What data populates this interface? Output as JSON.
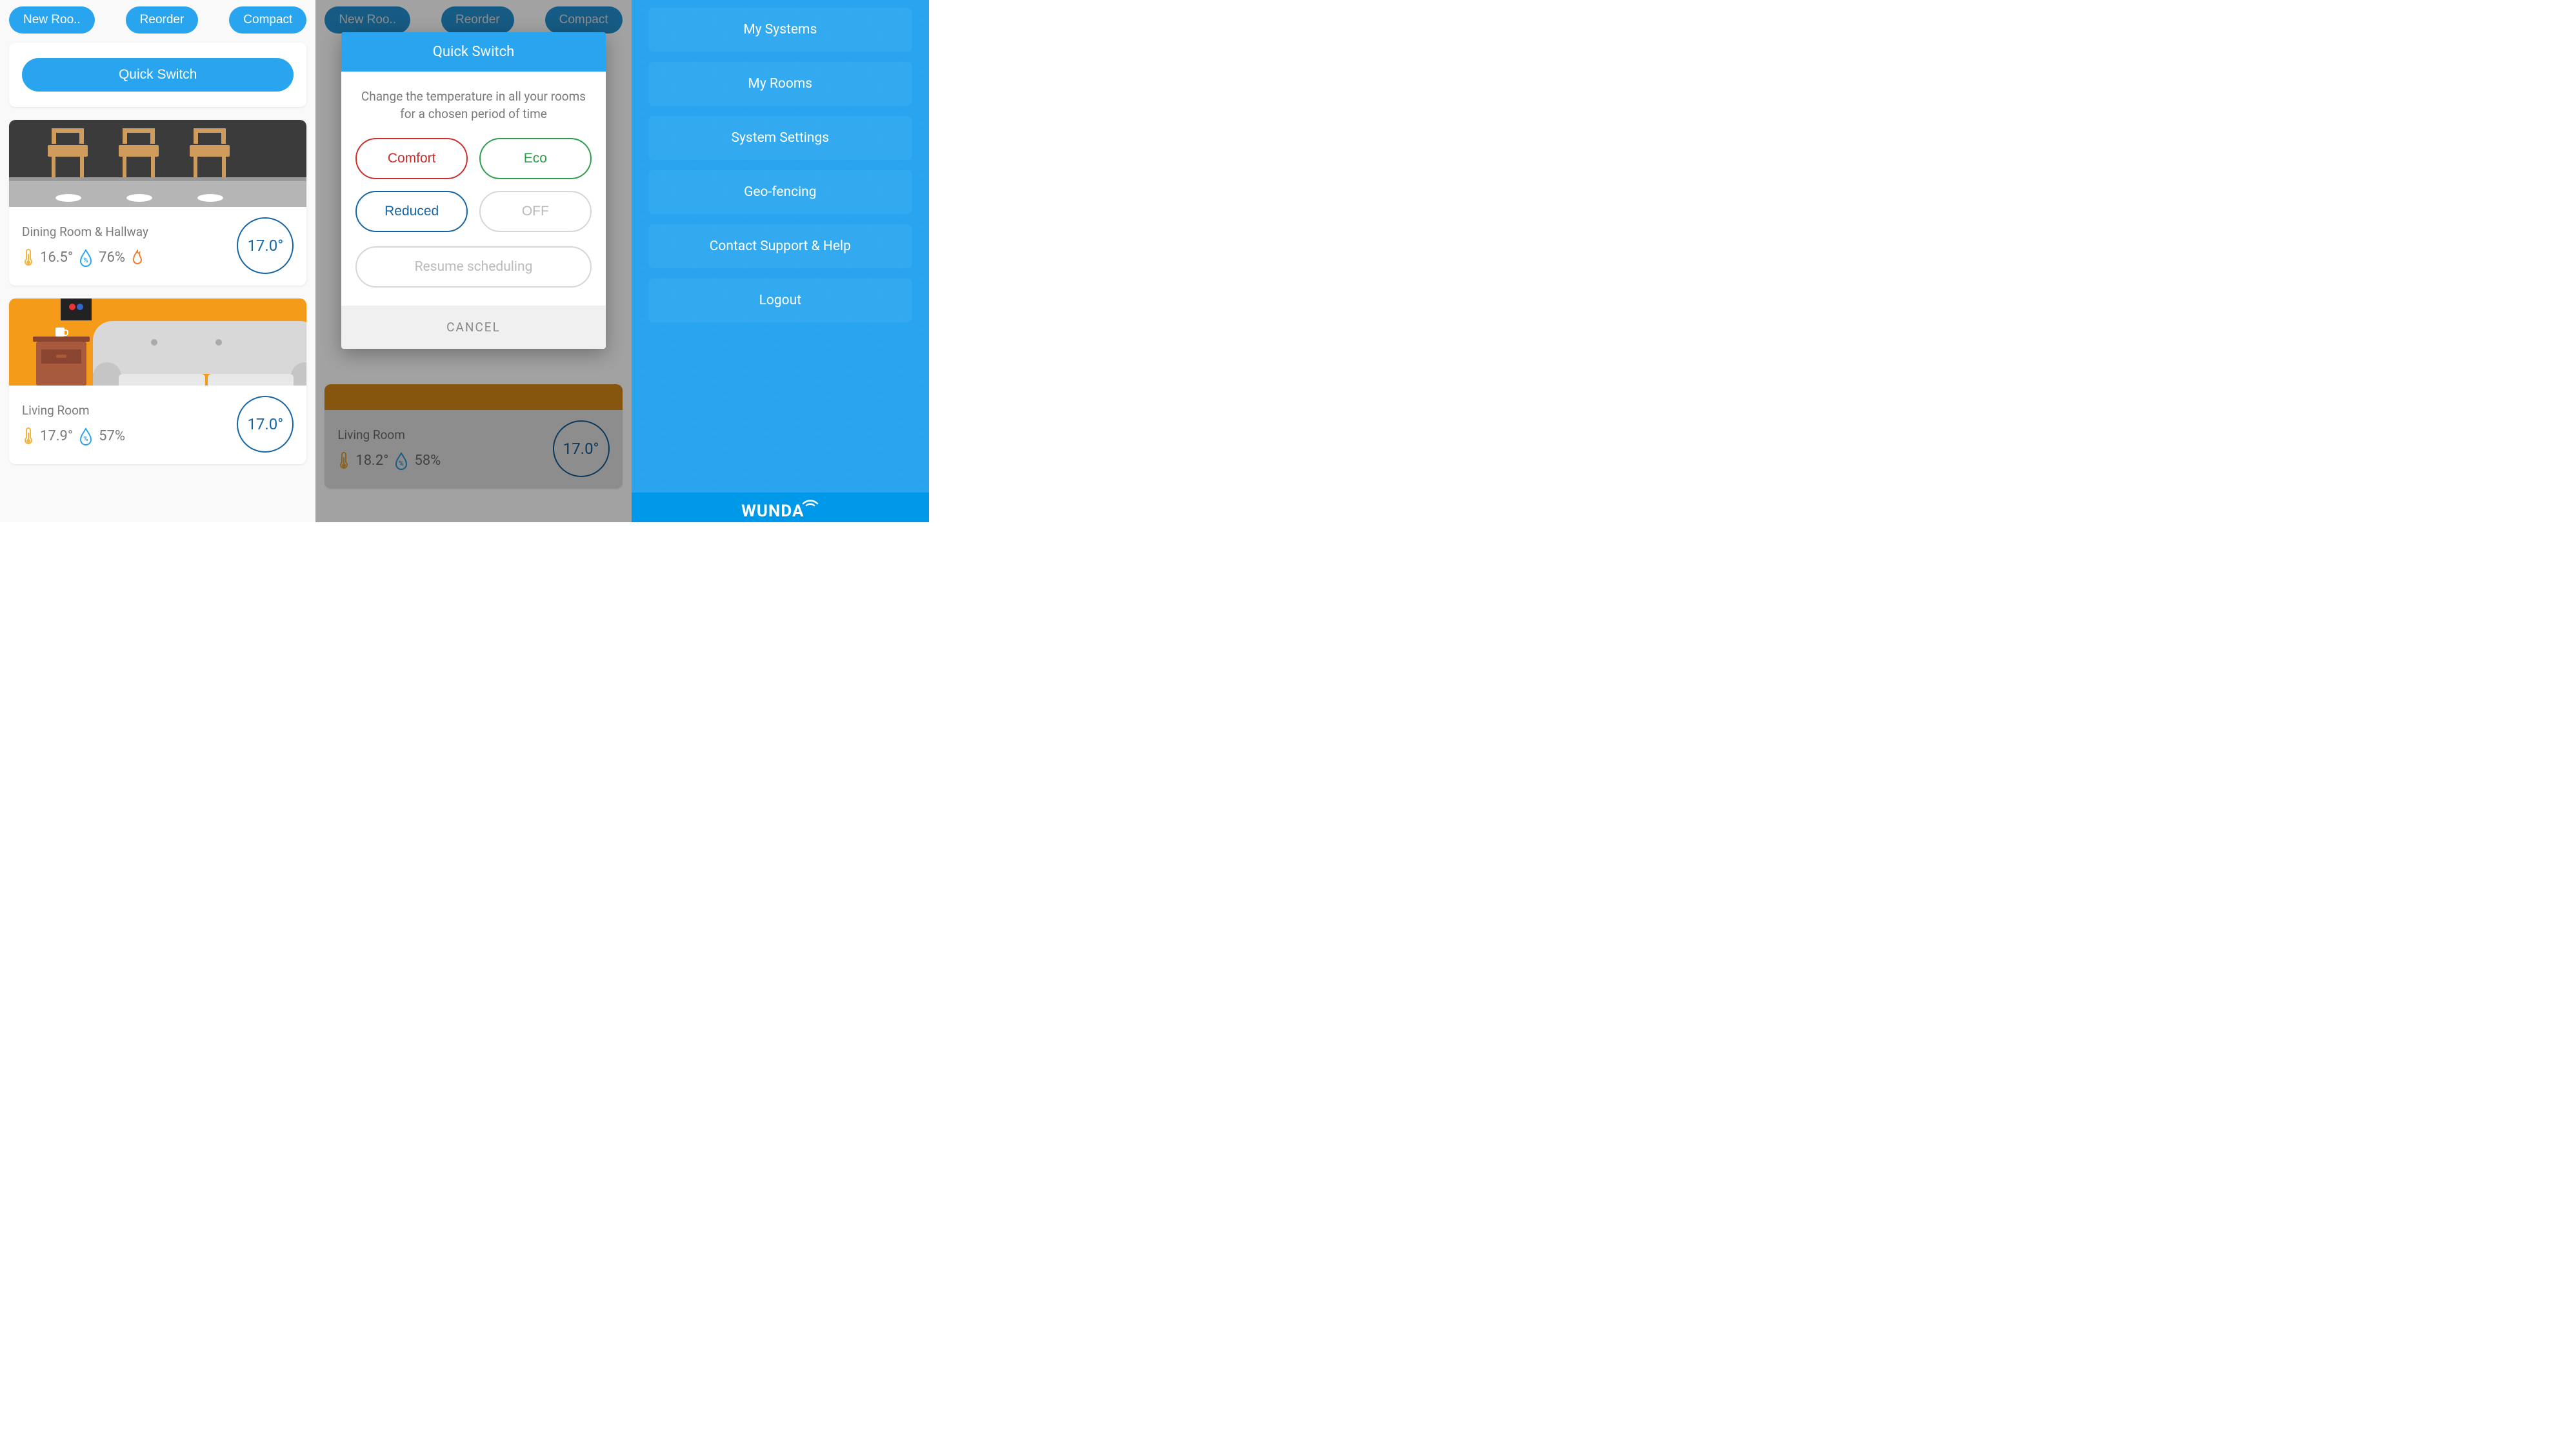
{
  "panel1": {
    "top_buttons": {
      "new_room": "New Roo..",
      "reorder": "Reorder",
      "compact": "Compact"
    },
    "quick_switch": "Quick Switch",
    "rooms": [
      {
        "name": "Dining Room & Hallway",
        "temp": "16.5°",
        "humidity": "76%",
        "target": "17.0°",
        "heating": true
      },
      {
        "name": "Living Room",
        "temp": "17.9°",
        "humidity": "57%",
        "target": "17.0°",
        "heating": false
      }
    ]
  },
  "panel2": {
    "top_buttons": {
      "new_room": "New Roo..",
      "reorder": "Reorder",
      "compact": "Compact"
    },
    "bg_room": {
      "name": "Living Room",
      "temp": "18.2°",
      "humidity": "58%",
      "target": "17.0°"
    },
    "modal": {
      "title": "Quick Switch",
      "desc": "Change the temperature in all your rooms for a chosen period of time",
      "comfort": "Comfort",
      "eco": "Eco",
      "reduced": "Reduced",
      "off": "OFF",
      "resume": "Resume scheduling",
      "cancel": "CANCEL"
    }
  },
  "panel3": {
    "menu": {
      "systems": "My Systems",
      "rooms": "My Rooms",
      "settings": "System Settings",
      "geo": "Geo-fencing",
      "support": "Contact Support & Help",
      "logout": "Logout"
    },
    "brand": "WUNDA"
  }
}
